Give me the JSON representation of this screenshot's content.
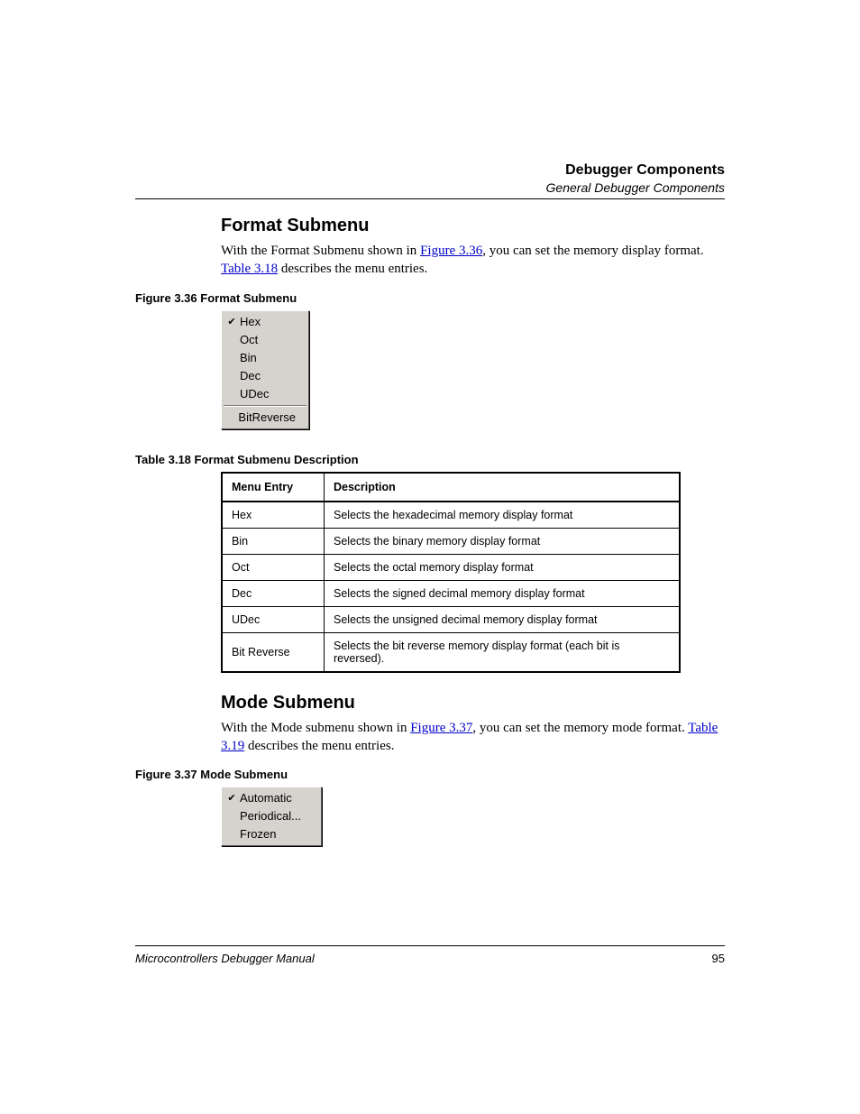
{
  "header": {
    "title_bold": "Debugger Components",
    "subtitle_italic": "General Debugger Components"
  },
  "section1": {
    "heading": "Format Submenu",
    "para_pre": "With the Format Submenu shown in ",
    "para_link1": "Figure 3.36",
    "para_mid": ", you can set the memory display format. ",
    "para_link2": "Table 3.18",
    "para_post": " describes the menu entries."
  },
  "figure1": {
    "caption": "Figure 3.36  Format Submenu",
    "items": [
      {
        "checked": true,
        "label": "Hex"
      },
      {
        "checked": false,
        "label": "Oct"
      },
      {
        "checked": false,
        "label": "Bin"
      },
      {
        "checked": false,
        "label": "Dec"
      },
      {
        "checked": false,
        "label": "UDec"
      }
    ],
    "group2": [
      {
        "checked": false,
        "label": "BitReverse"
      }
    ]
  },
  "table1": {
    "caption": "Table 3.18  Format Submenu Description",
    "head_entry": "Menu Entry",
    "head_desc": "Description",
    "rows": [
      {
        "entry": "Hex",
        "desc": "Selects the hexadecimal memory display format"
      },
      {
        "entry": "Bin",
        "desc": "Selects the binary memory display format"
      },
      {
        "entry": "Oct",
        "desc": "Selects the octal memory display format"
      },
      {
        "entry": "Dec",
        "desc": "Selects the signed decimal memory display format"
      },
      {
        "entry": "UDec",
        "desc": "Selects the unsigned decimal memory display format"
      },
      {
        "entry": "Bit Reverse",
        "desc": "Selects the bit reverse memory display format (each bit is reversed)."
      }
    ]
  },
  "section2": {
    "heading": "Mode Submenu",
    "para_pre": "With the Mode submenu shown in ",
    "para_link1": "Figure 3.37",
    "para_mid": ", you can set the memory mode format. ",
    "para_link2": "Table 3.19",
    "para_post": " describes the menu entries."
  },
  "figure2": {
    "caption": "Figure 3.37  Mode Submenu",
    "items": [
      {
        "checked": true,
        "label": "Automatic"
      },
      {
        "checked": false,
        "label": "Periodical..."
      },
      {
        "checked": false,
        "label": "Frozen"
      }
    ]
  },
  "footer": {
    "manual": "Microcontrollers Debugger Manual",
    "page": "95"
  }
}
